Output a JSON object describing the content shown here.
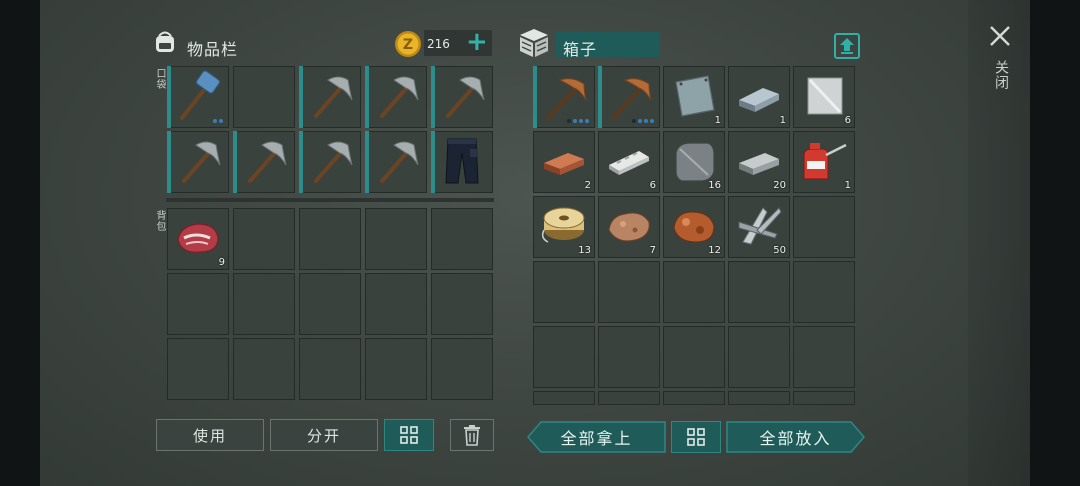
{
  "inventory": {
    "title": "物品栏",
    "pocket_label": "口袋",
    "backpack_label": "背包",
    "coins": "216",
    "add_coins": "+",
    "pocket_slots": [
      {
        "icon": "sledgehammer-icon",
        "dots": [
          1,
          1
        ]
      },
      {
        "icon": "",
        "dots": []
      },
      {
        "icon": "pickaxe-icon"
      },
      {
        "icon": "pickaxe-icon"
      },
      {
        "icon": "pickaxe-icon"
      },
      {
        "icon": "pickaxe-icon"
      },
      {
        "icon": "pickaxe-icon"
      },
      {
        "icon": "pickaxe-icon"
      },
      {
        "icon": "pickaxe-icon"
      },
      {
        "icon": "pants-icon"
      }
    ],
    "backpack_slots": [
      {
        "icon": "raw-meat-icon",
        "count": "9"
      }
    ],
    "buttons": {
      "use": "使用",
      "split": "分开"
    }
  },
  "box": {
    "title": "箱子",
    "slots": [
      {
        "icon": "copper-pickaxe-icon",
        "dots": [
          0,
          1,
          1,
          1
        ]
      },
      {
        "icon": "copper-pickaxe-icon",
        "dots": [
          0,
          1,
          1,
          1
        ]
      },
      {
        "icon": "metal-plate-icon",
        "count": "1"
      },
      {
        "icon": "iron-ingot-icon",
        "count": "1"
      },
      {
        "icon": "steel-plate-icon",
        "count": "6"
      },
      {
        "icon": "copper-bar-icon",
        "count": "2"
      },
      {
        "icon": "silver-bar-icon",
        "count": "6"
      },
      {
        "icon": "iron-plate-icon",
        "count": "16"
      },
      {
        "icon": "steel-ingot-icon",
        "count": "20"
      },
      {
        "icon": "oil-can-icon",
        "count": "1"
      },
      {
        "icon": "wire-spool-icon",
        "count": "13"
      },
      {
        "icon": "copper-ore-icon",
        "count": "7"
      },
      {
        "icon": "copper-nugget-icon",
        "count": "12"
      },
      {
        "icon": "scrap-metal-icon",
        "count": "50"
      }
    ],
    "buttons": {
      "take_all": "全部拿上",
      "put_all": "全部放入"
    }
  },
  "close_label": "关闭",
  "colors": {
    "accent": "#2d8884",
    "slot": "#3a423e",
    "coin": "#e0a920"
  }
}
